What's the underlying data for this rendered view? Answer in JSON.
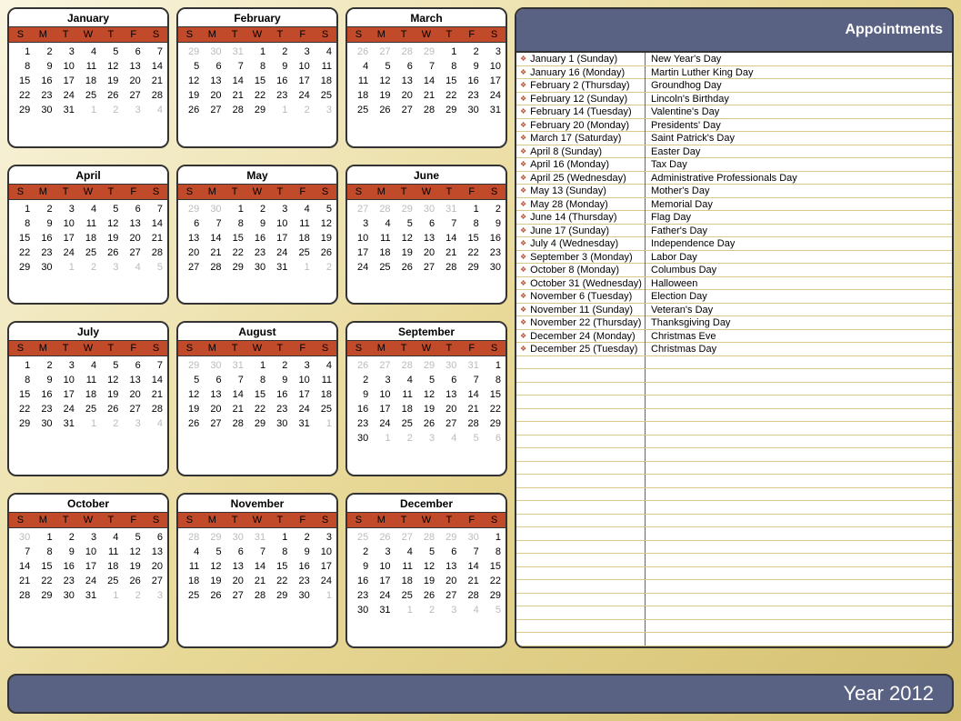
{
  "year_label": "Year 2012",
  "appointments_title": "Appointments",
  "dow": [
    "S",
    "M",
    "T",
    "W",
    "T",
    "F",
    "S"
  ],
  "months": [
    {
      "name": "January",
      "start": 0,
      "days": 31,
      "prev": 31
    },
    {
      "name": "February",
      "start": 3,
      "days": 29,
      "prev": 31
    },
    {
      "name": "March",
      "start": 4,
      "days": 31,
      "prev": 29
    },
    {
      "name": "April",
      "start": 0,
      "days": 30,
      "prev": 31
    },
    {
      "name": "May",
      "start": 2,
      "days": 31,
      "prev": 30
    },
    {
      "name": "June",
      "start": 5,
      "days": 30,
      "prev": 31
    },
    {
      "name": "July",
      "start": 0,
      "days": 31,
      "prev": 30
    },
    {
      "name": "August",
      "start": 3,
      "days": 31,
      "prev": 31
    },
    {
      "name": "September",
      "start": 6,
      "days": 30,
      "prev": 31
    },
    {
      "name": "October",
      "start": 1,
      "days": 31,
      "prev": 30
    },
    {
      "name": "November",
      "start": 4,
      "days": 30,
      "prev": 31
    },
    {
      "name": "December",
      "start": 6,
      "days": 31,
      "prev": 30
    }
  ],
  "appointments": [
    {
      "date": "January 1 (Sunday)",
      "event": "New Year's Day"
    },
    {
      "date": "January 16 (Monday)",
      "event": "Martin Luther King Day"
    },
    {
      "date": "February 2 (Thursday)",
      "event": "Groundhog Day"
    },
    {
      "date": "February 12 (Sunday)",
      "event": "Lincoln's Birthday"
    },
    {
      "date": "February 14 (Tuesday)",
      "event": "Valentine's Day"
    },
    {
      "date": "February 20 (Monday)",
      "event": "Presidents' Day"
    },
    {
      "date": "March 17 (Saturday)",
      "event": "Saint Patrick's Day"
    },
    {
      "date": "April 8 (Sunday)",
      "event": "Easter Day"
    },
    {
      "date": "April 16 (Monday)",
      "event": "Tax Day"
    },
    {
      "date": "April 25 (Wednesday)",
      "event": "Administrative Professionals Day"
    },
    {
      "date": "May 13 (Sunday)",
      "event": "Mother's Day"
    },
    {
      "date": "May 28 (Monday)",
      "event": "Memorial Day"
    },
    {
      "date": "June 14 (Thursday)",
      "event": "Flag Day"
    },
    {
      "date": "June 17 (Sunday)",
      "event": "Father's Day"
    },
    {
      "date": "July 4 (Wednesday)",
      "event": "Independence Day"
    },
    {
      "date": "September 3 (Monday)",
      "event": "Labor Day"
    },
    {
      "date": "October 8 (Monday)",
      "event": "Columbus Day"
    },
    {
      "date": "October 31 (Wednesday)",
      "event": "Halloween"
    },
    {
      "date": "November 6 (Tuesday)",
      "event": "Election Day"
    },
    {
      "date": "November 11 (Sunday)",
      "event": "Veteran's Day"
    },
    {
      "date": "November 22 (Thursday)",
      "event": "Thanksgiving Day"
    },
    {
      "date": "December 24 (Monday)",
      "event": "Christmas Eve"
    },
    {
      "date": "December 25 (Tuesday)",
      "event": "Christmas Day"
    }
  ],
  "empty_rows": 22
}
